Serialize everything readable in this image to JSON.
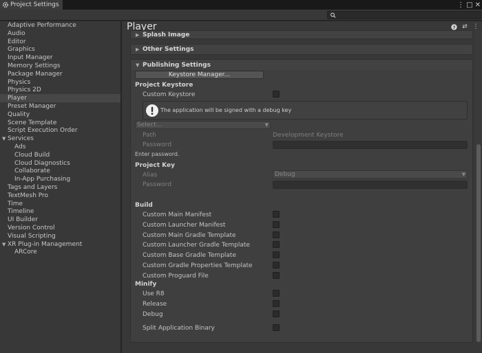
{
  "window": {
    "tab_title": "Project Settings",
    "menu_glyph": "⋮",
    "maximize_glyph": "□",
    "close_glyph": "✕"
  },
  "search": {
    "placeholder": ""
  },
  "sidebar": {
    "items": [
      {
        "label": "Adaptive Performance",
        "indent": 0
      },
      {
        "label": "Audio",
        "indent": 0
      },
      {
        "label": "Editor",
        "indent": 0
      },
      {
        "label": "Graphics",
        "indent": 0
      },
      {
        "label": "Input Manager",
        "indent": 0
      },
      {
        "label": "Memory Settings",
        "indent": 0
      },
      {
        "label": "Package Manager",
        "indent": 0
      },
      {
        "label": "Physics",
        "indent": 0
      },
      {
        "label": "Physics 2D",
        "indent": 0
      },
      {
        "label": "Player",
        "indent": 0,
        "selected": true
      },
      {
        "label": "Preset Manager",
        "indent": 0
      },
      {
        "label": "Quality",
        "indent": 0
      },
      {
        "label": "Scene Template",
        "indent": 0
      },
      {
        "label": "Script Execution Order",
        "indent": 0
      },
      {
        "label": "Services",
        "indent": 0,
        "foldout": true
      },
      {
        "label": "Ads",
        "indent": 1
      },
      {
        "label": "Cloud Build",
        "indent": 1
      },
      {
        "label": "Cloud Diagnostics",
        "indent": 1
      },
      {
        "label": "Collaborate",
        "indent": 1
      },
      {
        "label": "In-App Purchasing",
        "indent": 1
      },
      {
        "label": "Tags and Layers",
        "indent": 0
      },
      {
        "label": "TextMesh Pro",
        "indent": 0
      },
      {
        "label": "Time",
        "indent": 0
      },
      {
        "label": "Timeline",
        "indent": 0
      },
      {
        "label": "UI Builder",
        "indent": 0
      },
      {
        "label": "Version Control",
        "indent": 0
      },
      {
        "label": "Visual Scripting",
        "indent": 0
      },
      {
        "label": "XR Plug-in Management",
        "indent": 0,
        "foldout": true
      },
      {
        "label": "ARCore",
        "indent": 1
      }
    ]
  },
  "main": {
    "title": "Player",
    "help_glyph": "?",
    "settings_glyph": "⇄",
    "menu_glyph": "⋮",
    "splash_image": "Splash Image",
    "other_settings": "Other Settings",
    "publishing_settings": "Publishing Settings",
    "keystore_manager_button": "Keystore Manager...",
    "project_keystore": {
      "heading": "Project Keystore",
      "custom_keystore": "Custom Keystore",
      "help_message": "The application will be signed with a debug key",
      "select_placeholder": "Select...",
      "path_label": "Path",
      "path_value": "Development Keystore",
      "password_label": "Password",
      "enter_password": "Enter password."
    },
    "project_key": {
      "heading": "Project Key",
      "alias_label": "Alias",
      "alias_value": "Debug",
      "password_label": "Password"
    },
    "build": {
      "heading": "Build",
      "items": [
        "Custom Main Manifest",
        "Custom Launcher Manifest",
        "Custom Main Gradle Template",
        "Custom Launcher Gradle Template",
        "Custom Base Gradle Template",
        "Custom Gradle Properties Template",
        "Custom Proguard File"
      ]
    },
    "minify": {
      "heading": "Minify",
      "items": [
        "Use R8",
        "Release",
        "Debug"
      ]
    },
    "split_binary": "Split Application Binary"
  }
}
